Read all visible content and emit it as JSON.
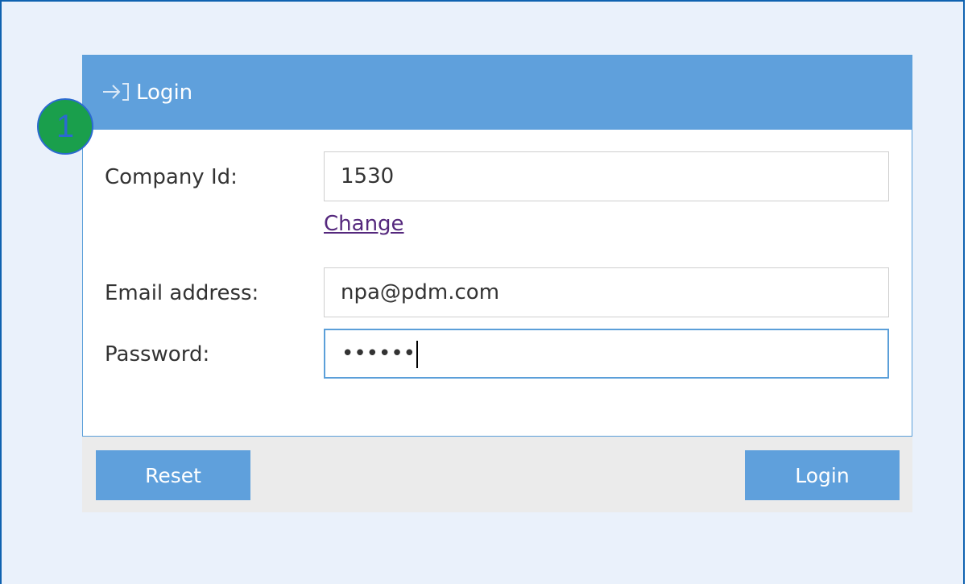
{
  "header": {
    "icon": "sign-in-arrow-icon",
    "title": "Login"
  },
  "step_badge": "1",
  "form": {
    "company_id_label": "Company Id:",
    "company_id_value": "1530",
    "change_link": "Change",
    "email_label": "Email address:",
    "email_value": "npa@pdm.com",
    "password_label": "Password:",
    "password_value": "••••••"
  },
  "buttons": {
    "reset": "Reset",
    "login": "Login"
  },
  "colors": {
    "accent": "#5fa0dc",
    "badge": "#1a9f4c",
    "link_visited": "#55287d",
    "background": "#eaf1fb"
  }
}
